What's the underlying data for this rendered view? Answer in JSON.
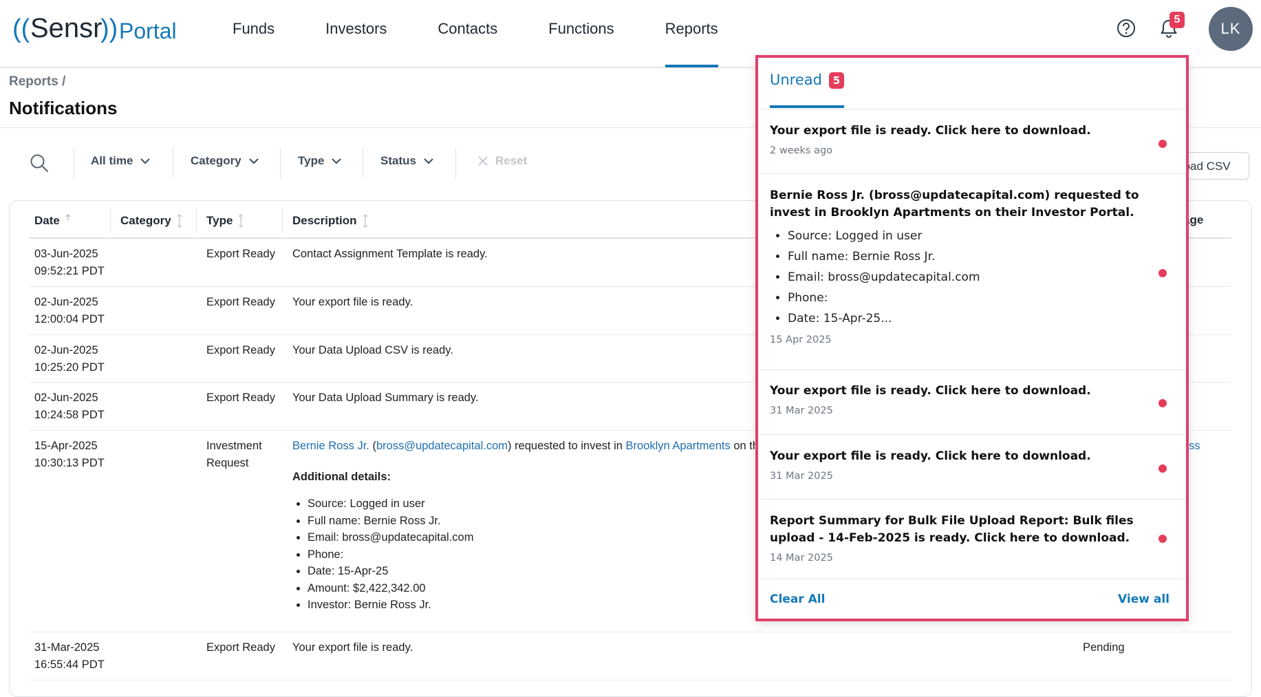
{
  "app": {
    "logo_text": "((Sensr)) Portal",
    "brand_color": "#1478b8",
    "alert_color": "#e63c5c",
    "highlight_color": "#e0416b"
  },
  "nav": {
    "items": [
      {
        "label": "Funds",
        "active": false
      },
      {
        "label": "Investors",
        "active": false
      },
      {
        "label": "Contacts",
        "active": false
      },
      {
        "label": "Functions",
        "active": false
      },
      {
        "label": "Reports",
        "active": true
      }
    ],
    "help_icon": "question-circle-icon",
    "bell_icon": "bell-icon",
    "bell_count": "5",
    "avatar_initials": "LK"
  },
  "page": {
    "breadcrumb": "Reports /",
    "title": "Notifications"
  },
  "filters": {
    "search_icon": "search-icon",
    "items": [
      "All time",
      "Category",
      "Type",
      "Status"
    ],
    "reset_label": "Reset",
    "download_label": "nload CSV"
  },
  "table": {
    "headers": [
      "Date",
      "Category",
      "Type",
      "Description",
      "age"
    ],
    "rows": [
      {
        "date": "03-Jun-2025",
        "time": "09:52:21 PDT",
        "type": "Export Ready",
        "desc": "Contact Assignment Template is ready."
      },
      {
        "date": "02-Jun-2025",
        "time": "12:00:04 PDT",
        "type": "Export Ready",
        "desc": "Your export file is ready."
      },
      {
        "date": "02-Jun-2025",
        "time": "10:25:20 PDT",
        "type": "Export Ready",
        "desc": "Your Data Upload CSV is ready."
      },
      {
        "date": "02-Jun-2025",
        "time": "10:24:58 PDT",
        "type": "Export Ready",
        "desc": "Your Data Upload Summary is ready."
      },
      {
        "date": "15-Apr-2025",
        "time": "10:30:13 PDT",
        "type_line1": "Investment",
        "type_line2": "Request",
        "desc_link_name": "Bernie Ross Jr.",
        "desc_paren_open": " (",
        "desc_link_email": "bross@updatecapital.com",
        "desc_mid": ") requested to invest in ",
        "desc_link_asset": "Brooklyn Apartments",
        "desc_tail": " on th",
        "additional_label": "Additional details:",
        "details": [
          "Source: Logged in user",
          "Full name: Bernie Ross Jr.",
          "Email: bross@updatecapital.com",
          "Phone:",
          "Date: 15-Apr-25",
          "Amount: $2,422,342.00",
          "Investor: Bernie Ross Jr."
        ],
        "right_fragment": "ss"
      },
      {
        "date": "31-Mar-2025",
        "time": "16:55:44 PDT",
        "type": "Export Ready",
        "desc": "Your export file is ready.",
        "status": "Pending"
      }
    ]
  },
  "panel": {
    "tab_label": "Unread",
    "tab_count": "5",
    "notifications": [
      {
        "title": "Your export file is ready. Click here to download.",
        "time": "2 weeks ago"
      },
      {
        "title": "Bernie Ross Jr. (bross@updatecapital.com) requested to invest in Brooklyn Apartments on their Investor Portal.",
        "bullets": [
          "Source: Logged in user",
          "Full name: Bernie Ross Jr.",
          "Email: bross@updatecapital.com",
          "Phone:",
          "Date: 15-Apr-25..."
        ],
        "time": "15 Apr 2025"
      },
      {
        "title": "Your export file is ready. Click here to download.",
        "time": "31 Mar 2025"
      },
      {
        "title": "Your export file is ready. Click here to download.",
        "time": "31 Mar 2025"
      },
      {
        "title": "Report Summary for Bulk File Upload Report: Bulk files upload - 14-Feb-2025 is ready. Click here to download.",
        "time": "14 Mar 2025"
      }
    ],
    "clear_all_label": "Clear All",
    "view_all_label": "View all"
  }
}
